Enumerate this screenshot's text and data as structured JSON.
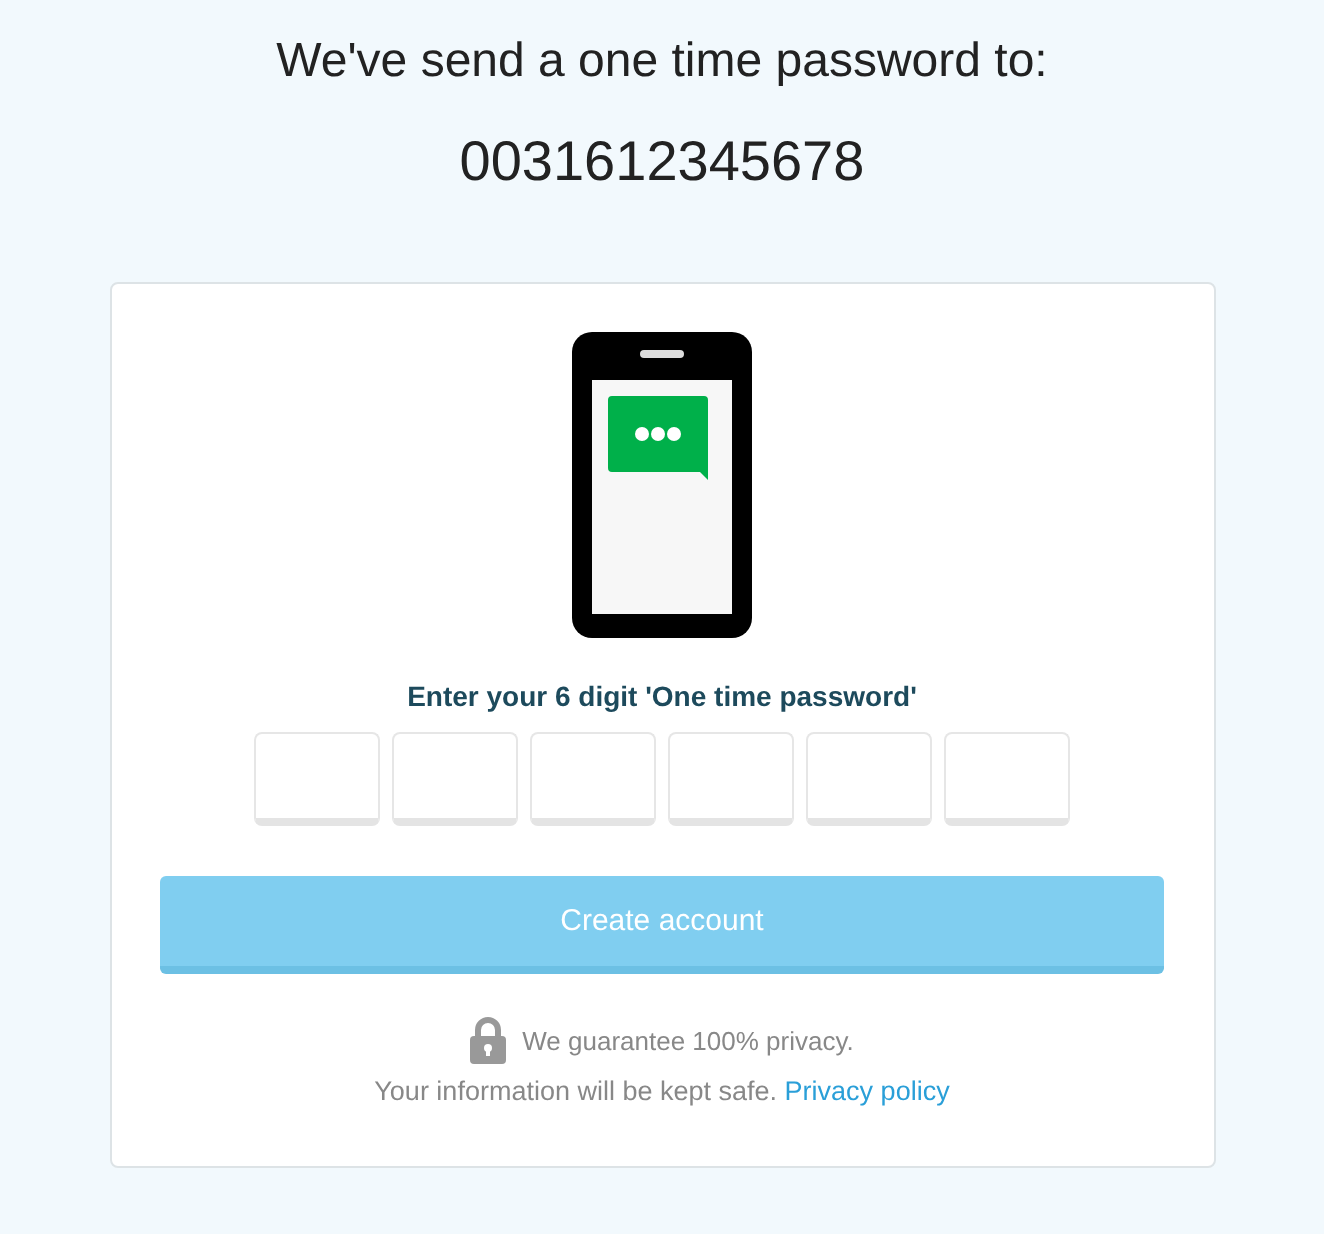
{
  "heading": "We've send a one time password to:",
  "phone_number": "0031612345678",
  "otp": {
    "label": "Enter your 6 digit 'One time password'",
    "fields": [
      {
        "kind": "digit"
      },
      {
        "kind": "digit"
      },
      {
        "kind": "digit"
      },
      {
        "kind": "digit"
      },
      {
        "kind": "digit"
      },
      {
        "kind": "digit"
      }
    ]
  },
  "submit_button": {
    "label": "Create account",
    "disabled": true
  },
  "privacy": {
    "guarantee": "We guarantee 100% privacy.",
    "note": "Your information will be kept safe.",
    "link": "Privacy policy"
  }
}
